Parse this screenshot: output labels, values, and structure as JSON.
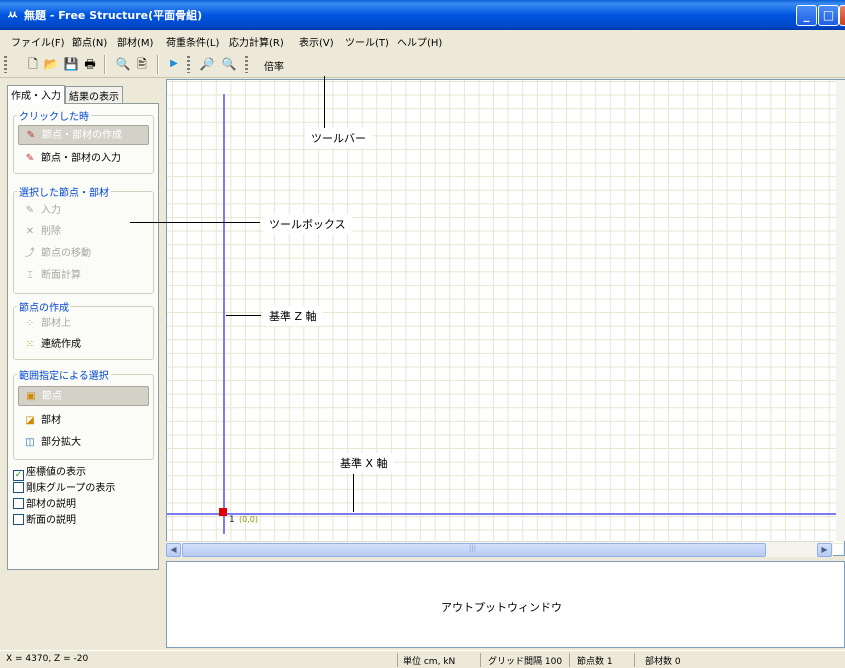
{
  "window": {
    "title": "無題 - Free Structure(平面骨組)",
    "app_icon": "ㅆ",
    "controls": {
      "minimize": "_",
      "maximize": "□",
      "close": "X"
    }
  },
  "menu": [
    "ファイル(F)",
    "節点(N)",
    "部材(M)",
    "荷重条件(L)",
    "応力計算(R)",
    "表示(V)",
    "ツール(T)",
    "ヘルプ(H)"
  ],
  "toolbar": {
    "icons": [
      "new-file-icon",
      "open-folder-icon",
      "save-icon",
      "print-icon",
      "preview-icon",
      "page-setup-icon",
      "run-icon",
      "zoom-in-icon",
      "zoom-out-icon"
    ],
    "glyphs": {
      "new": "🗋",
      "open": "📂",
      "save": "💾",
      "print": "🖶",
      "preview": "🔍",
      "page": "🖹",
      "run": "▶",
      "zoom_in": "🔎",
      "zoom_out": "🔍"
    },
    "zoom_label": "倍率"
  },
  "tabs": {
    "input": "作成・入力",
    "results": "結果の表示"
  },
  "panel": {
    "on_click": {
      "title": "クリックした時",
      "create": "節点・部材の作成",
      "input": "節点・部材の入力"
    },
    "selected": {
      "title": "選択した節点・部材",
      "input": "入力",
      "delete": "削除",
      "move": "節点の移動",
      "section": "断面計算"
    },
    "node_create": {
      "title": "節点の作成",
      "on_member": "部材上",
      "continuous": "連続作成"
    },
    "range_select": {
      "title": "範囲指定による選択",
      "node": "節点",
      "member": "部材",
      "zoom": "部分拡大"
    },
    "checks": [
      {
        "label": "座標値の表示",
        "checked": true
      },
      {
        "label": "剛床グループの表示",
        "checked": false
      },
      {
        "label": "部材の説明",
        "checked": false
      },
      {
        "label": "断面の説明",
        "checked": false
      }
    ],
    "check_mark": "✓"
  },
  "canvas": {
    "node_number": "1",
    "node_coord": "(0,0)",
    "scroll_center": "|||"
  },
  "output": {
    "text": "アウトプットウィンドウ"
  },
  "status": {
    "coords": "X = 4370,  Z = -20",
    "unit": "単位 cm, kN",
    "grid": "グリッド間隔 100",
    "nodes": "節点数 1",
    "members": "部材数 0"
  },
  "callouts": {
    "toolbar": "ツールバー",
    "toolbox": "ツールボックス",
    "z_axis": "基準 Z 軸",
    "x_axis": "基準 X 軸"
  }
}
